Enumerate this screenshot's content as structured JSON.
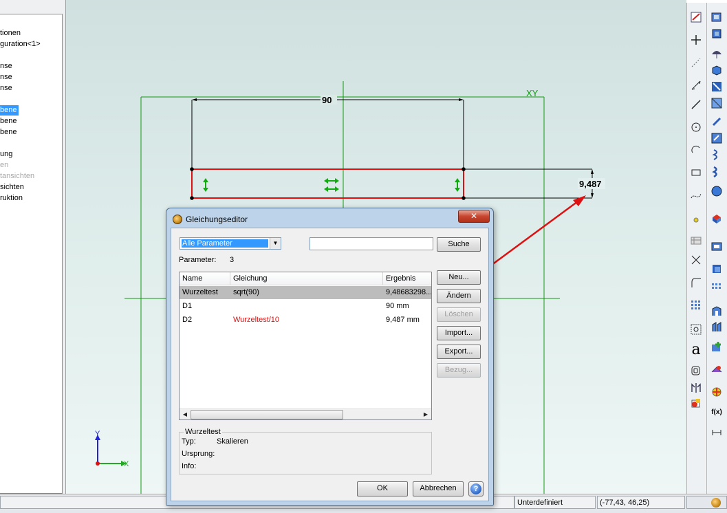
{
  "tree": {
    "items": [
      {
        "label": "tionen",
        "state": "normal"
      },
      {
        "label": "guration<1>",
        "state": "normal"
      },
      {
        "label": "nse",
        "state": "normal"
      },
      {
        "label": "nse",
        "state": "normal"
      },
      {
        "label": "nse",
        "state": "normal"
      },
      {
        "label": "bene",
        "state": "selected"
      },
      {
        "label": "bene",
        "state": "normal"
      },
      {
        "label": "bene",
        "state": "normal"
      },
      {
        "label": "ung",
        "state": "normal"
      },
      {
        "label": "en",
        "state": "disabled"
      },
      {
        "label": "tansichten",
        "state": "disabled"
      },
      {
        "label": "sichten",
        "state": "normal"
      },
      {
        "label": "ruktion",
        "state": "normal"
      }
    ]
  },
  "sketch": {
    "dimension_width": "90",
    "dimension_height": "9,487",
    "plane_label": "XY",
    "axis_x": "X",
    "axis_y": "Y",
    "colors": {
      "sketch_line": "#dd1111",
      "construction": "#118811",
      "dimension": "#000000",
      "relation": "#11aa11"
    }
  },
  "dialog": {
    "title": "Gleichungseditor",
    "close_label": "✕",
    "filter_value": "Alle Parameter",
    "search_value": "",
    "search_button": "Suche",
    "parameter_label": "Parameter:",
    "parameter_count": "3",
    "columns": [
      "Name",
      "Gleichung",
      "Ergebnis"
    ],
    "rows": [
      {
        "name": "Wurzeltest",
        "equation": "sqrt(90)",
        "result": "9,48683298...",
        "selected": true
      },
      {
        "name": "D1",
        "equation": "",
        "result": "90 mm",
        "selected": false
      },
      {
        "name": "D2",
        "equation": "Wurzeltest/10",
        "result": "9,487 mm",
        "selected": false
      }
    ],
    "buttons": {
      "new": "Neu...",
      "change": "Ändern",
      "delete": "Löschen",
      "import": "Import...",
      "export": "Export...",
      "reference": "Bezug..."
    },
    "details": {
      "group_title": "Wurzeltest",
      "type_label": "Typ:",
      "type_value": "Skalieren",
      "origin_label": "Ursprung:",
      "origin_value": "",
      "info_label": "Info:",
      "info_value": ""
    },
    "ok": "OK",
    "cancel": "Abbrechen",
    "help_glyph": "?"
  },
  "status": {
    "state": "Unterdefiniert",
    "coordinates": "(-77,43, 46,25)"
  },
  "toolbar_left": {
    "icons": [
      "sketch-icon",
      "point-plus-icon",
      "construction-line-icon",
      "dimension-icon",
      "line-icon",
      "circle-icon",
      "arc-icon",
      "rectangle-icon",
      "spline-icon",
      "point-icon",
      "table-icon",
      "trim-icon",
      "fillet-icon",
      "pattern-icon",
      "constraint-icon",
      "text-icon",
      "offset-icon",
      "mirror-icon",
      "color-icon"
    ],
    "text_tool": "a"
  },
  "toolbar_right": {
    "icons": [
      "view-icon",
      "cube-icon",
      "umbrella-icon",
      "box-icon",
      "cut-icon",
      "split-icon",
      "helix-icon",
      "spring-icon",
      "chamfer-icon",
      "sphere-icon",
      "part-icon",
      "frame-icon",
      "array-icon",
      "bridge-icon",
      "assembly-icon",
      "gear-icon",
      "brush-icon",
      "palette-icon",
      "function-icon",
      "measure-icon",
      "settings-icon"
    ],
    "function_label": "f(x)"
  }
}
